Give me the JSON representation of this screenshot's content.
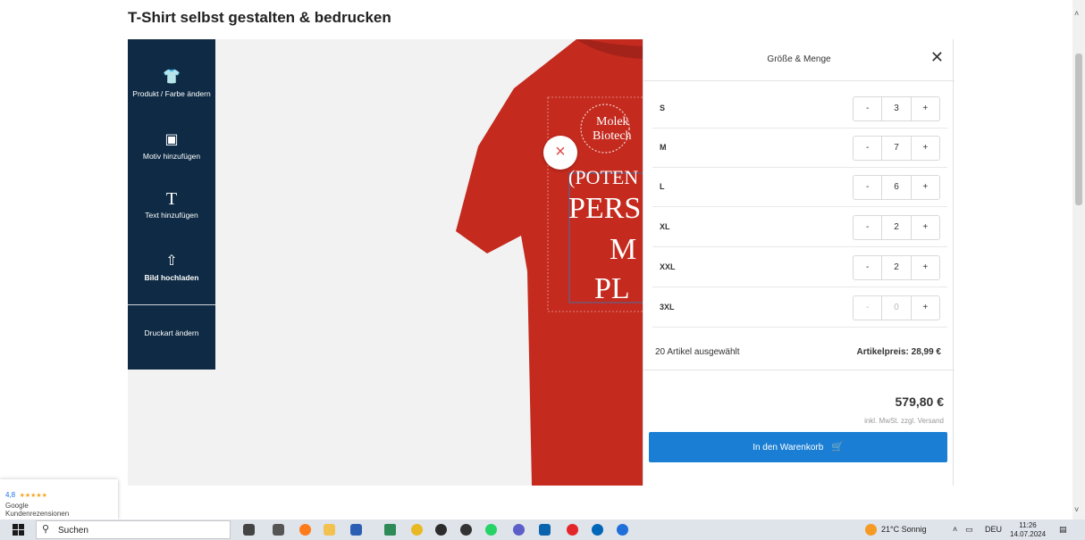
{
  "page": {
    "title": "T-Shirt selbst gestalten & bedrucken"
  },
  "tools": {
    "items": [
      {
        "label": "Produkt / Farbe ändern",
        "icon": "shirt-icon"
      },
      {
        "label": "Motiv hinzufügen",
        "icon": "image-icon"
      },
      {
        "label": "Text hinzufügen",
        "icon": "text-icon"
      },
      {
        "label": "Bild hochladen",
        "icon": "cloud-upload-icon"
      },
      {
        "label": "Druckart ändern",
        "icon": ""
      }
    ]
  },
  "design": {
    "shirt_color": "#c42a1e",
    "logo_line1": "Molek",
    "logo_line2": "Biotech",
    "text_line1": "(POTEN",
    "text_line2": "PERS",
    "text_line3": "M",
    "text_line4": "PL",
    "remove_icon": "×"
  },
  "panel": {
    "title": "Größe & Menge",
    "close_icon": "✕",
    "sizes": [
      {
        "size": "S",
        "qty": "3",
        "disabled": false
      },
      {
        "size": "M",
        "qty": "7",
        "disabled": false
      },
      {
        "size": "L",
        "qty": "6",
        "disabled": false
      },
      {
        "size": "XL",
        "qty": "2",
        "disabled": false
      },
      {
        "size": "XXL",
        "qty": "2",
        "disabled": false
      },
      {
        "size": "3XL",
        "qty": "0",
        "disabled": true
      }
    ],
    "dec_label": "-",
    "inc_label": "+",
    "selected_count": "20 Artikel ausgewählt",
    "unit_price": "Artikelpreis: 28,99 €",
    "total": "579,80 €",
    "tax_note": "inkl. MwSt. zzgl. Versand",
    "cart_button": "In den Warenkorb",
    "accent": "#1a7fd4"
  },
  "rating": {
    "score": "4,8",
    "stars": "★★★★★",
    "source": "Google",
    "label": "Kundenrezensionen"
  },
  "taskbar": {
    "search_placeholder": "Suchen",
    "weather": "21°C Sonnig",
    "language": "DEU",
    "time": "11:26",
    "date": "14.07.2024"
  }
}
